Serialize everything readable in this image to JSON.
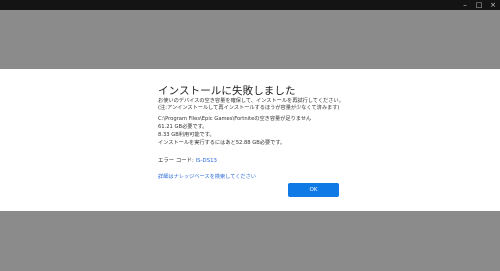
{
  "window": {
    "controls": {
      "minimize": "–",
      "maximize": "□",
      "close": "×"
    }
  },
  "dialog": {
    "title": "インストールに失敗しました",
    "messages": [
      "お使いのデバイスの空き容量を確保して、インストールを再試行してください。",
      "(注:アンインストールして再インストールするほうが容量が少なくて済みます)",
      "C:\\Program Files\\Epic Games\\Fortniteの空き容量が足りません",
      "61.21 GB必要です。",
      "8.33 GB利用可能です。",
      "インストールを実行するにはあと52.88 GB必要です。"
    ],
    "error_label": "エラー コード:",
    "error_code": "IS-DS13",
    "help_link": "詳細はナレッジベースを検索してください",
    "ok_button": "OK"
  },
  "colors": {
    "accent": "#0f79e6",
    "link": "#2a6bd8",
    "backdrop": "#8b8b8b",
    "titlebar": "#141414"
  }
}
